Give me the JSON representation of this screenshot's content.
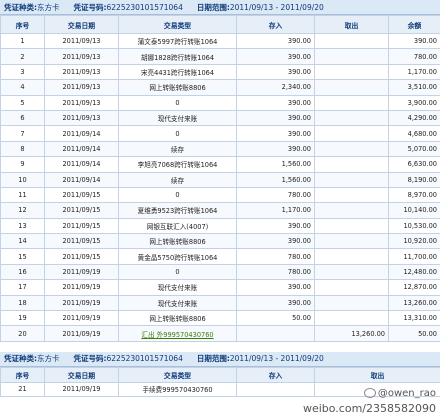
{
  "header": {
    "type_label": "凭证种类:",
    "type_value": "东方卡",
    "number_label": "凭证号码:",
    "number_value": "6225230101571064",
    "date_label": "日期范围:",
    "date_value": "2011/09/13 - 2011/09/20"
  },
  "columns": [
    "序号",
    "交易日期",
    "交易类型",
    "存入",
    "取出",
    "余额"
  ],
  "rows": [
    {
      "no": "1",
      "date": "2011/09/13",
      "type": "蒲文泰5997跨行转账1064",
      "in": "390.00",
      "out": "",
      "bal": "390.00"
    },
    {
      "no": "2",
      "date": "2011/09/13",
      "type": "胡娜1828跨行转账1064",
      "in": "390.00",
      "out": "",
      "bal": "780.00"
    },
    {
      "no": "3",
      "date": "2011/09/13",
      "type": "宋亮4431跨行转账1064",
      "in": "390.00",
      "out": "",
      "bal": "1,170.00"
    },
    {
      "no": "4",
      "date": "2011/09/13",
      "type": "网上转账转账8806",
      "in": "2,340.00",
      "out": "",
      "bal": "3,510.00"
    },
    {
      "no": "5",
      "date": "2011/09/13",
      "type": "0",
      "in": "390.00",
      "out": "",
      "bal": "3,900.00"
    },
    {
      "no": "6",
      "date": "2011/09/13",
      "type": "现代支付来账",
      "in": "390.00",
      "out": "",
      "bal": "4,290.00"
    },
    {
      "no": "7",
      "date": "2011/09/14",
      "type": "0",
      "in": "390.00",
      "out": "",
      "bal": "4,680.00"
    },
    {
      "no": "8",
      "date": "2011/09/14",
      "type": "续存",
      "in": "390.00",
      "out": "",
      "bal": "5,070.00"
    },
    {
      "no": "9",
      "date": "2011/09/14",
      "type": "李旭亮7068跨行转账1064",
      "in": "1,560.00",
      "out": "",
      "bal": "6,630.00"
    },
    {
      "no": "10",
      "date": "2011/09/14",
      "type": "续存",
      "in": "1,560.00",
      "out": "",
      "bal": "8,190.00"
    },
    {
      "no": "11",
      "date": "2011/09/15",
      "type": "0",
      "in": "780.00",
      "out": "",
      "bal": "8,970.00"
    },
    {
      "no": "12",
      "date": "2011/09/15",
      "type": "夏维勇9523跨行转账1064",
      "in": "1,170.00",
      "out": "",
      "bal": "10,140.00"
    },
    {
      "no": "13",
      "date": "2011/09/15",
      "type": "网银互联汇入(4007)",
      "in": "390.00",
      "out": "",
      "bal": "10,530.00"
    },
    {
      "no": "14",
      "date": "2011/09/15",
      "type": "网上转账转账8806",
      "in": "390.00",
      "out": "",
      "bal": "10,920.00"
    },
    {
      "no": "15",
      "date": "2011/09/15",
      "type": "黄金晶5750跨行转账1064",
      "in": "780.00",
      "out": "",
      "bal": "11,700.00"
    },
    {
      "no": "16",
      "date": "2011/09/19",
      "type": "0",
      "in": "780.00",
      "out": "",
      "bal": "12,480.00"
    },
    {
      "no": "17",
      "date": "2011/09/19",
      "type": "现代支付来账",
      "in": "390.00",
      "out": "",
      "bal": "12,870.00"
    },
    {
      "no": "18",
      "date": "2011/09/19",
      "type": "现代支付来账",
      "in": "390.00",
      "out": "",
      "bal": "13,260.00"
    },
    {
      "no": "19",
      "date": "2011/09/19",
      "type": "网上转账转账8806",
      "in": "50.00",
      "out": "",
      "bal": "13,310.00"
    },
    {
      "no": "20",
      "date": "2011/09/19",
      "type": "汇出 外999570430760",
      "in": "",
      "out": "13,260.00",
      "bal": "50.00"
    }
  ],
  "header2": {
    "type_label": "凭证种类:",
    "type_value": "东方卡",
    "number_label": "凭证号码:",
    "number_value": "6225230101571064",
    "date_label": "日期范围:",
    "date_value": "2011/09/13 - 2011/09/20"
  },
  "columns2": [
    "序号",
    "交易日期",
    "交易类型",
    "存入",
    "取出"
  ],
  "rows2": [
    {
      "no": "21",
      "date": "2011/09/19",
      "type": "手续费999570430760",
      "in": "",
      "out": ""
    }
  ],
  "watermark": {
    "line1": "@owen_rao",
    "line2": "weibo.com/2358582090"
  }
}
